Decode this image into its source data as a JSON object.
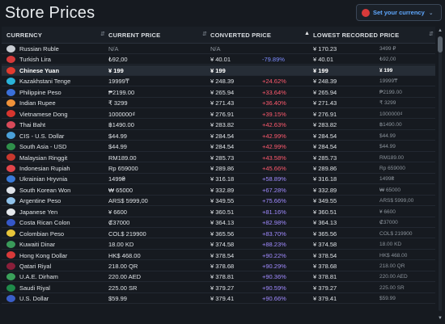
{
  "header": {
    "title": "Store Prices",
    "currency_button": "Set your currency",
    "currency_flag_color": "#d83a3a"
  },
  "table": {
    "columns": {
      "currency": "CURRENCY",
      "current_price": "CURRENT PRICE",
      "converted_price": "CONVERTED PRICE",
      "lowest_price": "LOWEST RECORDED PRICE"
    },
    "sorted_column": "converted_price",
    "sort_direction": "ascending",
    "rows": [
      {
        "name": "Russian Ruble",
        "flag": "#c9cdd3",
        "price": "N/A",
        "converted": "N/A",
        "pct": "",
        "pct_type": "none",
        "lowest": "¥ 170.23",
        "lowest_local": "3499 ₽",
        "na": true
      },
      {
        "name": "Turkish Lira",
        "flag": "#d43a3a",
        "price": "₺92,00",
        "converted": "¥ 40.01",
        "pct": "-79.89%",
        "pct_type": "down",
        "lowest": "¥ 40.01",
        "lowest_local": "₺92,00"
      },
      {
        "name": "Chinese Yuan",
        "flag": "#e23b2e",
        "price": "¥ 199",
        "converted": "¥ 199",
        "pct": "",
        "pct_type": "none",
        "lowest": "¥ 199",
        "lowest_local": "¥ 199",
        "highlight": true
      },
      {
        "name": "Kazakhstani Tenge",
        "flag": "#2ab3d9",
        "price": "19999₸",
        "converted": "¥ 248.39",
        "pct": "+24.62%",
        "pct_type": "up",
        "lowest": "¥ 248.39",
        "lowest_local": "19999₸"
      },
      {
        "name": "Philippine Peso",
        "flag": "#3a6fd8",
        "price": "₱2199.00",
        "converted": "¥ 265.94",
        "pct": "+33.64%",
        "pct_type": "up",
        "lowest": "¥ 265.94",
        "lowest_local": "₱2199.00"
      },
      {
        "name": "Indian Rupee",
        "flag": "#f0923a",
        "price": "₹ 3299",
        "converted": "¥ 271.43",
        "pct": "+36.40%",
        "pct_type": "up",
        "lowest": "¥ 271.43",
        "lowest_local": "₹ 3299"
      },
      {
        "name": "Vietnamese Dong",
        "flag": "#d8352e",
        "price": "1000000₫",
        "converted": "¥ 276.91",
        "pct": "+39.15%",
        "pct_type": "up",
        "lowest": "¥ 276.91",
        "lowest_local": "1000000₫"
      },
      {
        "name": "Thai Baht",
        "flag": "#d94a5a",
        "price": "฿1490.00",
        "converted": "¥ 283.82",
        "pct": "+42.63%",
        "pct_type": "up",
        "lowest": "¥ 283.82",
        "lowest_local": "฿1490.00"
      },
      {
        "name": "CIS - U.S. Dollar",
        "flag": "#4aa0d8",
        "price": "$44.99",
        "converted": "¥ 284.54",
        "pct": "+42.99%",
        "pct_type": "up",
        "lowest": "¥ 284.54",
        "lowest_local": "$44.99"
      },
      {
        "name": "South Asia - USD",
        "flag": "#2f8f4a",
        "price": "$44.99",
        "converted": "¥ 284.54",
        "pct": "+42.99%",
        "pct_type": "up",
        "lowest": "¥ 284.54",
        "lowest_local": "$44.99"
      },
      {
        "name": "Malaysian Ringgit",
        "flag": "#c8382e",
        "price": "RM189.00",
        "converted": "¥ 285.73",
        "pct": "+43.58%",
        "pct_type": "up",
        "lowest": "¥ 285.73",
        "lowest_local": "RM189.00"
      },
      {
        "name": "Indonesian Rupiah",
        "flag": "#e0454a",
        "price": "Rp 659000",
        "converted": "¥ 289.86",
        "pct": "+45.66%",
        "pct_type": "up",
        "lowest": "¥ 289.86",
        "lowest_local": "Rp 659000"
      },
      {
        "name": "Ukrainian Hryvnia",
        "flag": "#3a7ad8",
        "price": "1499₴",
        "converted": "¥ 316.18",
        "pct": "+58.89%",
        "pct_type": "purple",
        "lowest": "¥ 316.18",
        "lowest_local": "1499₴"
      },
      {
        "name": "South Korean Won",
        "flag": "#dfe3e8",
        "price": "₩ 65000",
        "converted": "¥ 332.89",
        "pct": "+67.28%",
        "pct_type": "purple",
        "lowest": "¥ 332.89",
        "lowest_local": "₩ 65000"
      },
      {
        "name": "Argentine Peso",
        "flag": "#8fc2ea",
        "price": "ARS$ 5999,00",
        "converted": "¥ 349.55",
        "pct": "+75.66%",
        "pct_type": "purple",
        "lowest": "¥ 349.55",
        "lowest_local": "ARS$ 5999,00"
      },
      {
        "name": "Japanese Yen",
        "flag": "#e6e9ec",
        "price": "¥ 6600",
        "converted": "¥ 360.51",
        "pct": "+81.16%",
        "pct_type": "purple",
        "lowest": "¥ 360.51",
        "lowest_local": "¥ 6600"
      },
      {
        "name": "Costa Rican Colon",
        "flag": "#3557c8",
        "price": "₡37000",
        "converted": "¥ 364.13",
        "pct": "+82.98%",
        "pct_type": "purple",
        "lowest": "¥ 364.13",
        "lowest_local": "₡37000"
      },
      {
        "name": "Colombian Peso",
        "flag": "#e8c53a",
        "price": "COL$ 219900",
        "converted": "¥ 365.56",
        "pct": "+83.70%",
        "pct_type": "purple",
        "lowest": "¥ 365.56",
        "lowest_local": "COL$ 219900"
      },
      {
        "name": "Kuwaiti Dinar",
        "flag": "#3a9a5a",
        "price": "18.00 KD",
        "converted": "¥ 374.58",
        "pct": "+88.23%",
        "pct_type": "purple",
        "lowest": "¥ 374.58",
        "lowest_local": "18.00 KD"
      },
      {
        "name": "Hong Kong Dollar",
        "flag": "#d93a3a",
        "price": "HK$ 468.00",
        "converted": "¥ 378.54",
        "pct": "+90.22%",
        "pct_type": "purple",
        "lowest": "¥ 378.54",
        "lowest_local": "HK$ 468.00"
      },
      {
        "name": "Qatari Riyal",
        "flag": "#8a1f3a",
        "price": "218.00 QR",
        "converted": "¥ 378.68",
        "pct": "+90.29%",
        "pct_type": "purple",
        "lowest": "¥ 378.68",
        "lowest_local": "218.00 QR"
      },
      {
        "name": "U.A.E. Dirham",
        "flag": "#3aa05a",
        "price": "220.00 AED",
        "converted": "¥ 378.81",
        "pct": "+90.36%",
        "pct_type": "purple",
        "lowest": "¥ 378.81",
        "lowest_local": "220.00 AED"
      },
      {
        "name": "Saudi Riyal",
        "flag": "#1f8a4a",
        "price": "225.00 SR",
        "converted": "¥ 379.27",
        "pct": "+90.59%",
        "pct_type": "purple",
        "lowest": "¥ 379.27",
        "lowest_local": "225.00 SR"
      },
      {
        "name": "U.S. Dollar",
        "flag": "#3a5ec8",
        "price": "$59.99",
        "converted": "¥ 379.41",
        "pct": "+90.66%",
        "pct_type": "purple",
        "lowest": "¥ 379.41",
        "lowest_local": "$59.99"
      }
    ]
  }
}
